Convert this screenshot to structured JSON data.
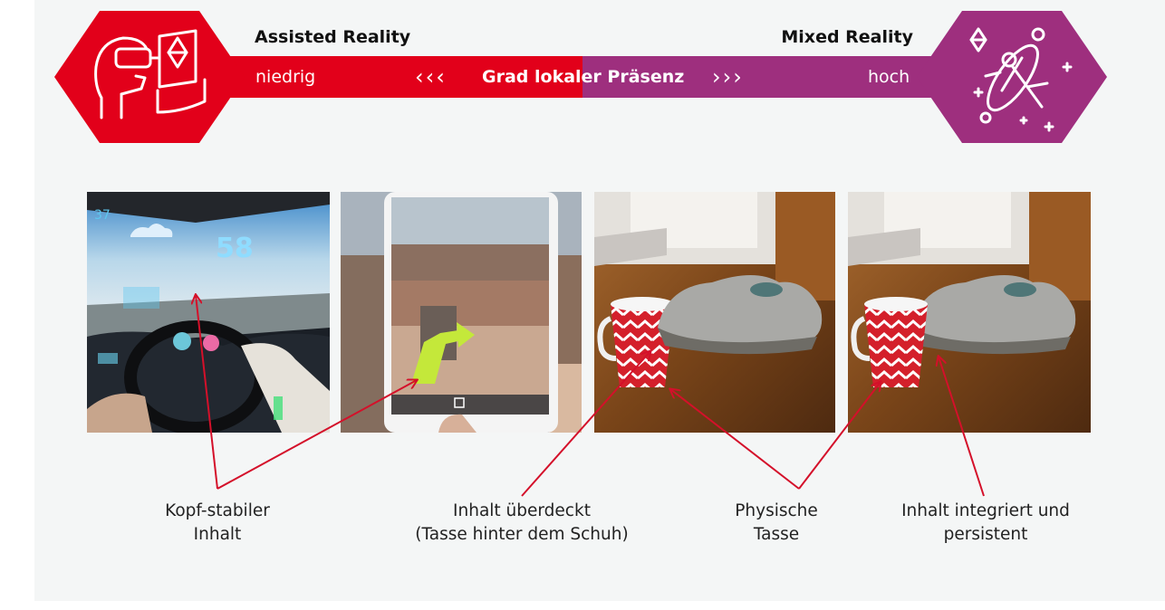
{
  "scale": {
    "left_heading": "Assisted Reality",
    "right_heading": "Mixed Reality",
    "low_label": "niedrig",
    "center_label": "Grad lokaler Präsenz",
    "center_label_part1": "Grad loka",
    "center_label_part2": "ler Präsenz",
    "high_label": "hoch",
    "left_arrows": "‹‹‹",
    "right_arrows": "›››"
  },
  "colors": {
    "assisted_red": "#e2001a",
    "mixed_purple": "#9e2f7e",
    "panel_bg": "#f4f6f6",
    "pointer_red": "#d4102a"
  },
  "icons": {
    "left_hexagon": "vr-headset-person-icon",
    "right_hexagon": "mixed-reality-surfer-icon"
  },
  "photos": [
    {
      "name": "car-dashboard-hud-photo"
    },
    {
      "name": "smartphone-ar-navigation-photo"
    },
    {
      "name": "cup-behind-shoe-occluded-photo"
    },
    {
      "name": "cup-in-front-of-shoe-integrated-photo"
    }
  ],
  "captions": [
    {
      "line1": "Kopf-stabiler",
      "line2": "Inhalt"
    },
    {
      "line1": "Inhalt überdeckt",
      "line2": "(Tasse hinter dem Schuh)"
    },
    {
      "line1": "Physische",
      "line2": "Tasse"
    },
    {
      "line1": "Inhalt integriert und",
      "line2": "persistent"
    }
  ]
}
